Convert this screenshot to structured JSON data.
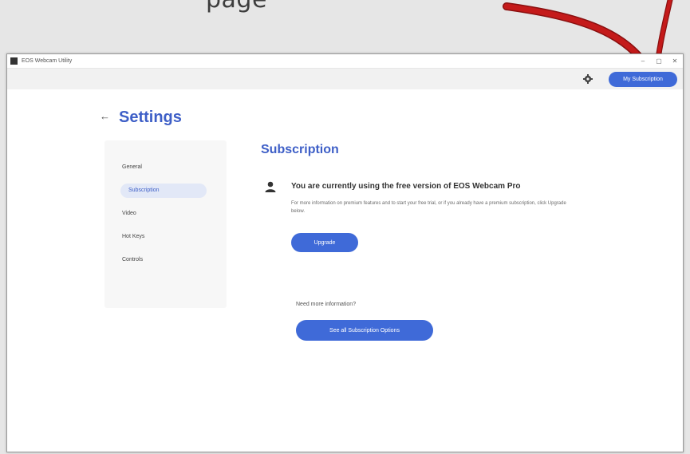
{
  "caption": {
    "text": "page"
  },
  "window": {
    "title": "EOS Webcam Utility",
    "controls": [
      "–",
      "▢",
      "✕"
    ]
  },
  "toolbar": {
    "settings_icon": "gear-icon",
    "my_subscription_label": "My Subscription"
  },
  "page": {
    "back_icon": "back-arrow-icon",
    "back_glyph": "←",
    "title": "Settings"
  },
  "nav": {
    "items": [
      {
        "label": "General",
        "active": false
      },
      {
        "label": "Subscription",
        "active": true
      },
      {
        "label": "Video",
        "active": false
      },
      {
        "label": "Hot Keys",
        "active": false
      },
      {
        "label": "Controls",
        "active": false
      }
    ]
  },
  "subscription": {
    "section_title": "Subscription",
    "user_icon": "user-icon",
    "heading": "You are currently using the free version of EOS Webcam Pro",
    "description": "For more information on premium features and to start your free trial, or if you already have a premium subscription, click Upgrade below.",
    "upgrade_label": "Upgrade"
  },
  "more": {
    "question": "Need more information?",
    "options_label": "See all Subscription Options"
  },
  "colors": {
    "accent": "#3f6ad8",
    "title_blue": "#3e5fc7",
    "annotation_arrow": "#c41a1a"
  }
}
